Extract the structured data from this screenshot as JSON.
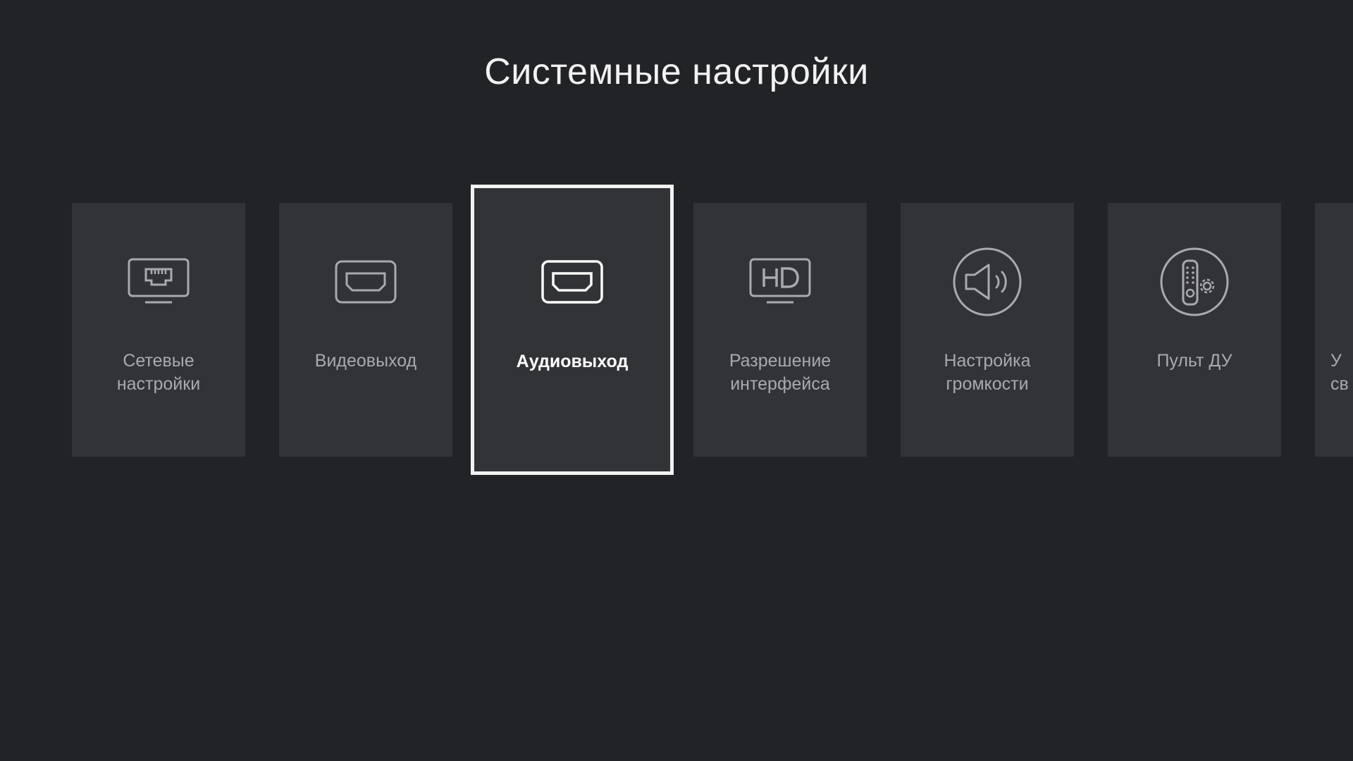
{
  "page": {
    "title": "Системные настройки"
  },
  "tiles": [
    {
      "id": "network",
      "label": "Сетевые\nнастройки",
      "icon": "ethernet-monitor-icon",
      "selected": false
    },
    {
      "id": "video",
      "label": "Видеовыход",
      "icon": "hdmi-port-icon",
      "selected": false
    },
    {
      "id": "audio",
      "label": "Аудиовыход",
      "icon": "hdmi-port-icon",
      "selected": true
    },
    {
      "id": "resolution",
      "label": "Разрешение\nинтерфейса",
      "icon": "hd-monitor-icon",
      "selected": false
    },
    {
      "id": "volume",
      "label": "Настройка\nгромкости",
      "icon": "speaker-icon",
      "selected": false
    },
    {
      "id": "remote",
      "label": "Пульт ДУ",
      "icon": "remote-gear-icon",
      "selected": false
    },
    {
      "id": "partial",
      "label": "У\nсв",
      "icon": "",
      "selected": false
    }
  ],
  "colors": {
    "background": "#222327",
    "tile": "#323337",
    "selected_border": "#f2f2f2",
    "label": "#a9aaad",
    "label_selected": "#ffffff"
  }
}
